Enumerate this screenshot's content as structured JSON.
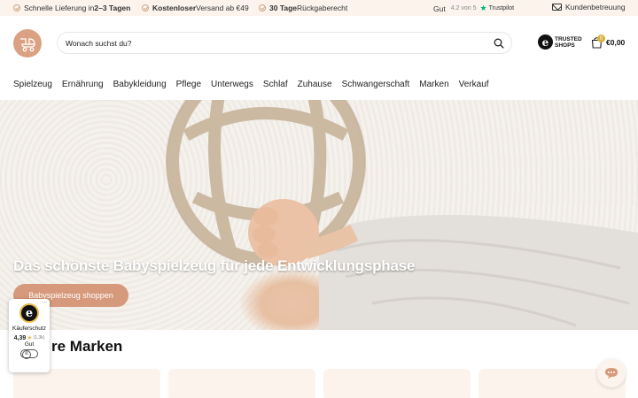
{
  "topbar": {
    "usp1_prefix": "Schnelle Lieferung in ",
    "usp1_bold": "2–3 Tagen",
    "usp2_bold": "Kostenloser",
    "usp2_suffix": " Versand ab €49",
    "usp3_bold": "30 Tage",
    "usp3_suffix": " Rückgaberecht",
    "trustpilot_label": "Gut",
    "trustpilot_score": "4.2 von 5",
    "trustpilot_name": "Trustpilot",
    "support_label": "Kundenbetreuung"
  },
  "header": {
    "search_placeholder": "Wonach suchst du?",
    "trusted_line1": "TRUSTED",
    "trusted_line2": "SHOPS",
    "cart_count": "0",
    "cart_total": "€0,00"
  },
  "nav": {
    "items": [
      "Spielzeug",
      "Ernährung",
      "Babykleidung",
      "Pflege",
      "Unterwegs",
      "Schlaf",
      "Zuhause",
      "Schwangerschaft",
      "Marken",
      "Verkauf"
    ]
  },
  "hero": {
    "title": "Das schönste Babyspielzeug für jede Entwicklungsphase",
    "button_label": "Babyspielzeug shoppen"
  },
  "brands": {
    "title_visible": "re Marken"
  },
  "trusted_widget": {
    "label": "Käuferschutz",
    "rating": "4,39",
    "count": "(1,3k)",
    "grade": "Gut",
    "menu": "..."
  },
  "colors": {
    "accent": "#d6997b",
    "topbar_bg": "#fbf3ec",
    "trustpilot_green": "#00b67a"
  },
  "icons": [
    "check-icon",
    "trustpilot-star-icon",
    "mail-icon",
    "stroller-logo-icon",
    "search-icon",
    "trusted-shops-icon",
    "cart-icon",
    "chat-icon"
  ]
}
